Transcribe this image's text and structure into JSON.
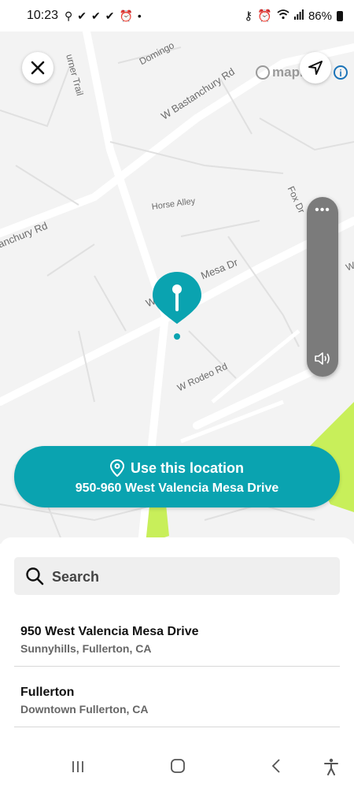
{
  "status_bar": {
    "time": "10:23",
    "left_icons": [
      "location-icon",
      "check-icon",
      "check-icon",
      "check-icon",
      "alarm-icon",
      "dot-icon"
    ],
    "battery": "86%"
  },
  "map": {
    "attribution": "mapbox",
    "street_labels": {
      "turner_trail": "urner Trail",
      "domingo": "Domingo",
      "bastanchury": "W Bastanchury Rd",
      "horse_alley": "Horse Alley",
      "fox_dr": "Fox Dr",
      "bastanchury_west": "anchury Rd",
      "mesa_dr": "Mesa Dr",
      "valencia_prefix": "W V",
      "rodeo": "W Rodeo Rd",
      "w_edge": "W"
    }
  },
  "location_button": {
    "title": "Use this location",
    "address": "950-960 West Valencia Mesa Drive"
  },
  "search": {
    "label": "Search"
  },
  "results": [
    {
      "title": "950 West Valencia Mesa Drive",
      "subtitle": "Sunnyhills, Fullerton, CA"
    },
    {
      "title": "Fullerton",
      "subtitle": "Downtown Fullerton, CA"
    }
  ],
  "colors": {
    "accent": "#0aa3b0",
    "map_bg": "#f3f3f3",
    "park": "#c8ef5a"
  }
}
